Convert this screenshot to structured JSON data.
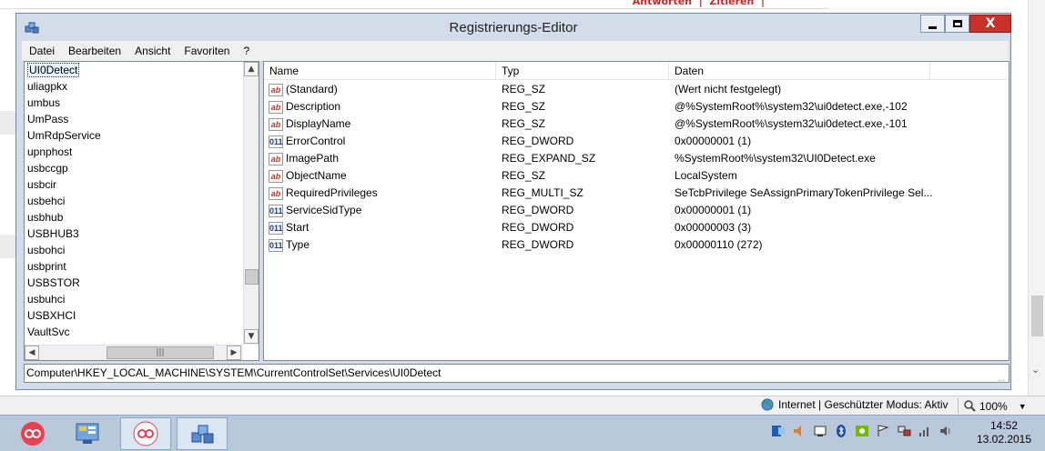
{
  "window": {
    "title": "Registrierungs-Editor",
    "close_label": "X"
  },
  "menu": [
    "Datei",
    "Bearbeiten",
    "Ansicht",
    "Favoriten",
    "?"
  ],
  "tree": {
    "items": [
      "UI0Detect",
      "uliagpkx",
      "umbus",
      "UmPass",
      "UmRdpService",
      "upnphost",
      "usbccgp",
      "usbcir",
      "usbehci",
      "usbhub",
      "USBHUB3",
      "usbohci",
      "usbprint",
      "USBSTOR",
      "usbuhci",
      "USBXHCI",
      "VaultSvc"
    ],
    "selected": "UI0Detect"
  },
  "list": {
    "columns": {
      "name": "Name",
      "type": "Typ",
      "data": "Daten"
    },
    "rows": [
      {
        "icon": "string-value-icon",
        "name": "(Standard)",
        "type": "REG_SZ",
        "data": "(Wert nicht festgelegt)"
      },
      {
        "icon": "string-value-icon",
        "name": "Description",
        "type": "REG_SZ",
        "data": "@%SystemRoot%\\system32\\ui0detect.exe,-102"
      },
      {
        "icon": "string-value-icon",
        "name": "DisplayName",
        "type": "REG_SZ",
        "data": "@%SystemRoot%\\system32\\ui0detect.exe,-101"
      },
      {
        "icon": "binary-value-icon",
        "name": "ErrorControl",
        "type": "REG_DWORD",
        "data": "0x00000001 (1)"
      },
      {
        "icon": "string-value-icon",
        "name": "ImagePath",
        "type": "REG_EXPAND_SZ",
        "data": "%SystemRoot%\\system32\\UI0Detect.exe"
      },
      {
        "icon": "string-value-icon",
        "name": "ObjectName",
        "type": "REG_SZ",
        "data": "LocalSystem"
      },
      {
        "icon": "string-value-icon",
        "name": "RequiredPrivileges",
        "type": "REG_MULTI_SZ",
        "data": "SeTcbPrivilege SeAssignPrimaryTokenPrivilege Sel..."
      },
      {
        "icon": "binary-value-icon",
        "name": "ServiceSidType",
        "type": "REG_DWORD",
        "data": "0x00000001 (1)"
      },
      {
        "icon": "binary-value-icon",
        "name": "Start",
        "type": "REG_DWORD",
        "data": "0x00000003 (3)"
      },
      {
        "icon": "binary-value-icon",
        "name": "Type",
        "type": "REG_DWORD",
        "data": "0x00000110 (272)"
      }
    ]
  },
  "status_path": "Computer\\HKEY_LOCAL_MACHINE\\SYSTEM\\CurrentControlSet\\Services\\UI0Detect",
  "ie": {
    "zone": "Internet | Geschützter Modus: Aktiv",
    "zoom": "100%"
  },
  "clock": {
    "time": "14:52",
    "date": "13.02.2015"
  },
  "colors": {
    "close_button": "#c8322b",
    "window_frame": "#d2dde9",
    "taskbar": "#b9c8da"
  }
}
